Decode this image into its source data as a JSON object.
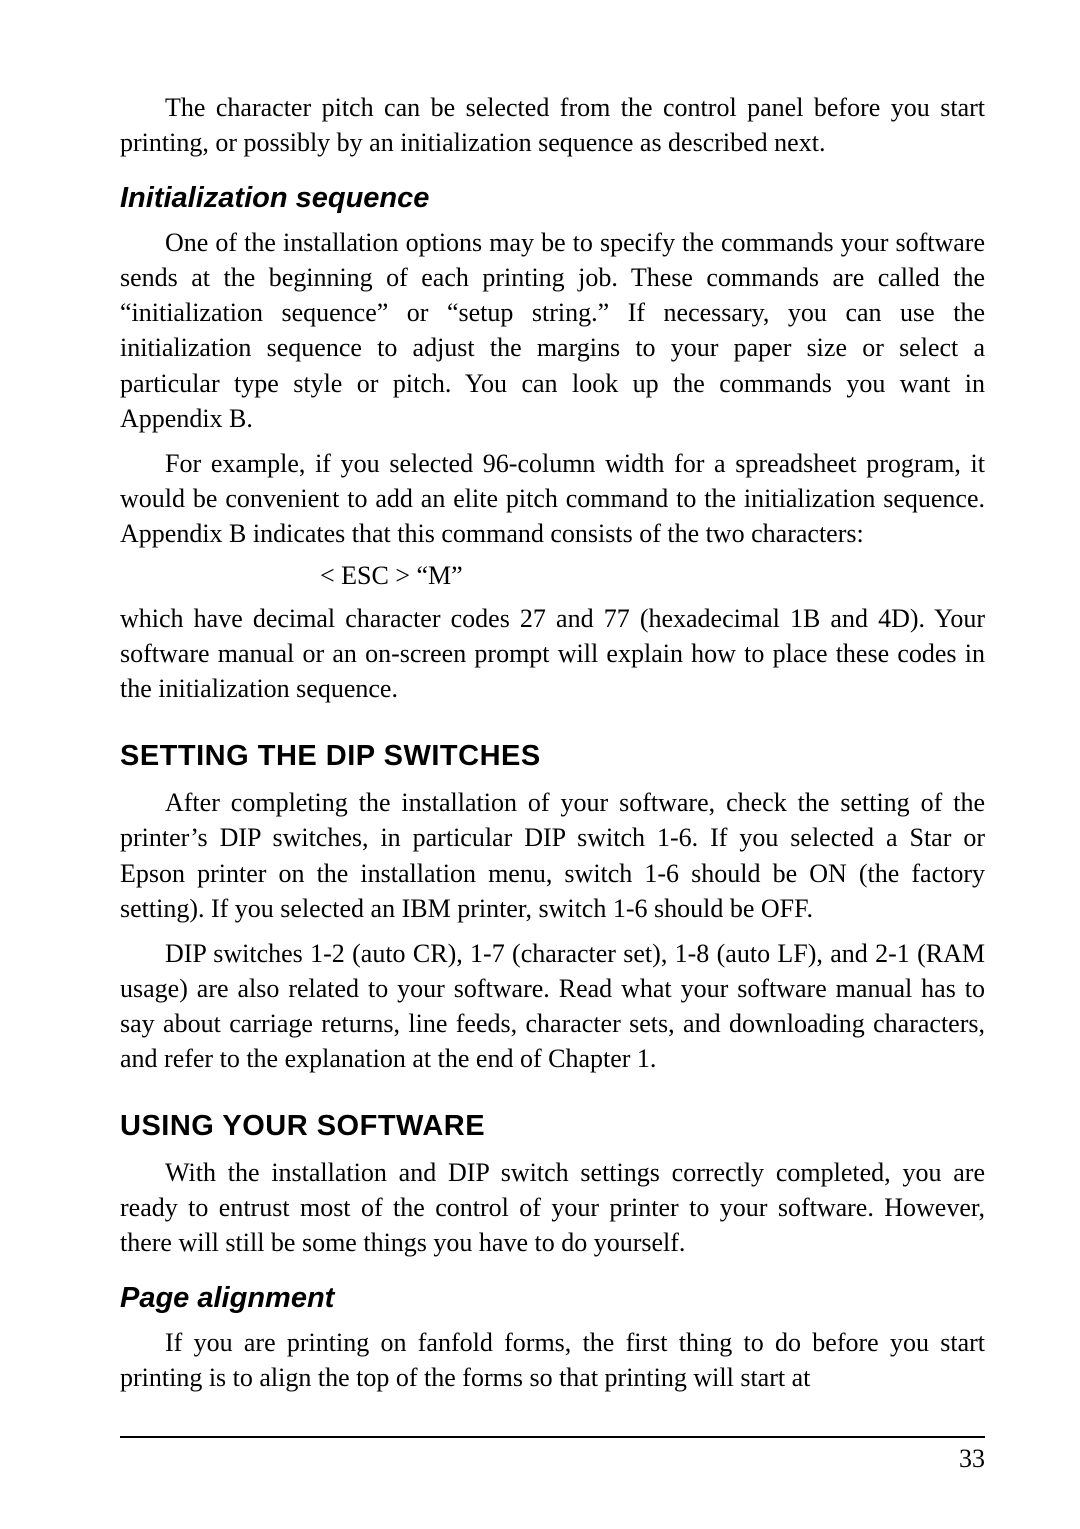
{
  "para_intro": "The character pitch can be selected from the control panel before you start printing, or possibly by an initialization sequence as described next.",
  "h_init": "Initialization sequence",
  "para_init1": "One of the installation options may be to specify the commands your software sends at the beginning of each printing job. These commands are called the “initialization sequence” or “setup string.” If necessary, you can use the initialization sequence to adjust the margins to your paper size or select a particular type style or pitch. You can look up the commands you want in Appendix B.",
  "para_init2": "For example, if you selected 96-column width for a spreadsheet program, it would be convenient to add an elite pitch command to the initialization sequence. Appendix B indicates that this command consists of the two characters:",
  "code_esc": "< ESC >  “M”",
  "para_init3": "which have decimal character codes 27 and 77 (hexadecimal 1B and 4D). Your software manual or an on-screen prompt will explain how to place these codes in the initialization sequence.",
  "h_dip": "SETTING THE DIP SWITCHES",
  "para_dip1": "After completing the installation of your software, check the setting of the printer’s DIP switches, in particular DIP switch 1-6. If you selected a Star or Epson printer on the installation menu, switch 1-6 should be ON (the factory setting). If you selected an IBM printer, switch 1-6 should be OFF.",
  "para_dip2": "DIP switches 1-2 (auto CR), 1-7 (character set), 1-8 (auto LF), and 2-1 (RAM usage) are also related to your software. Read what your software manual has to say about carriage returns, line feeds, character sets, and downloading characters, and refer to the explanation at the end of Chapter 1.",
  "h_using": "USING YOUR SOFTWARE",
  "para_using1": "With the installation and DIP switch settings correctly completed, you are ready to entrust most of the control of your printer to your software. However, there will still be some things you have to do yourself.",
  "h_page": "Page alignment",
  "para_page1": "If you are printing on fanfold forms, the first thing to do before you start printing is to align the top of the forms so that printing will start at",
  "page_number": "33"
}
